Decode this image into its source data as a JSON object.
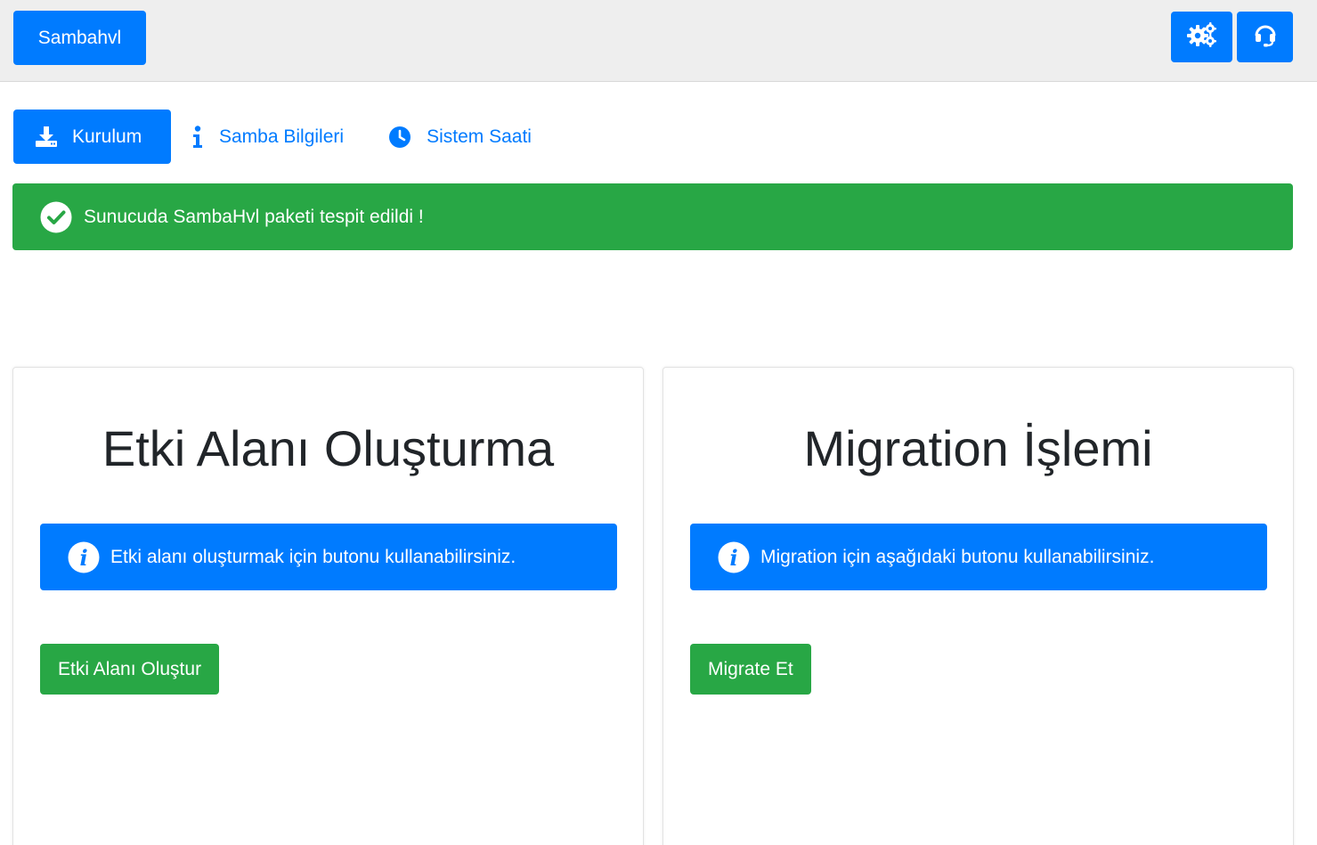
{
  "header": {
    "brand_label": "Sambahvl",
    "settings_icon": "cogs-icon",
    "support_icon": "headset-icon"
  },
  "tabs": [
    {
      "label": "Kurulum",
      "icon": "download-icon",
      "active": true
    },
    {
      "label": "Samba Bilgileri",
      "icon": "info-icon",
      "active": false
    },
    {
      "label": "Sistem Saati",
      "icon": "clock-icon",
      "active": false
    }
  ],
  "alert": {
    "text": "Sunucuda SambaHvl paketi tespit edildi !",
    "icon": "check-circle-icon"
  },
  "cards": [
    {
      "title": "Etki Alanı Oluşturma",
      "info_text": "Etki alanı oluşturmak için butonu kullanabilirsiniz.",
      "button_label": "Etki Alanı Oluştur"
    },
    {
      "title": "Migration İşlemi",
      "info_text": "Migration için aşağıdaki butonu kullanabilirsiniz.",
      "button_label": "Migrate Et"
    }
  ],
  "colors": {
    "primary": "#007bff",
    "success": "#28a745",
    "topbar_bg": "#eeeeee"
  }
}
